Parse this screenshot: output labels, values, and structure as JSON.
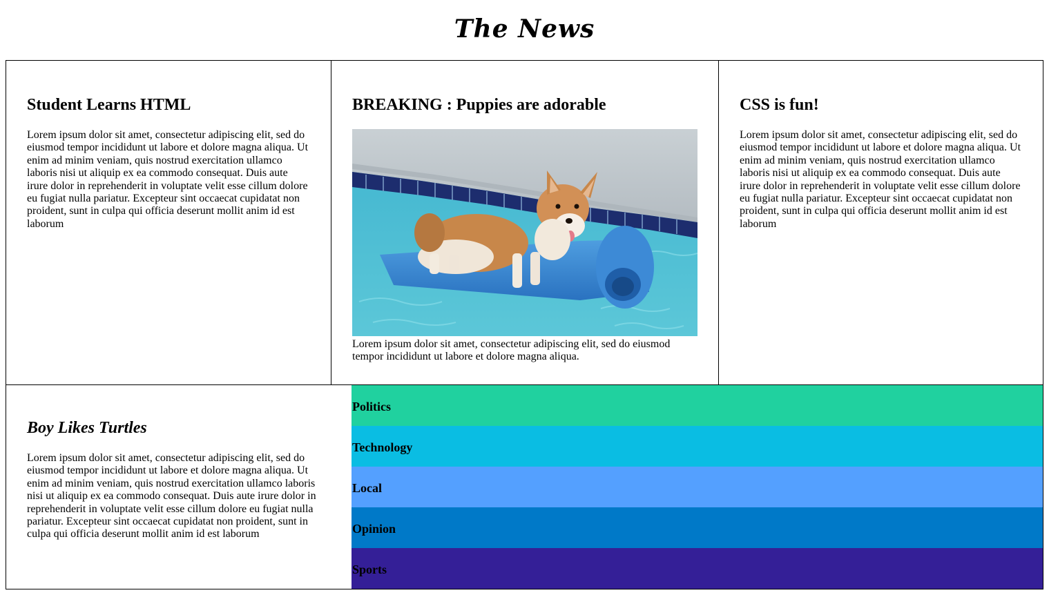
{
  "site": {
    "title": "The News"
  },
  "articles": [
    {
      "headline": "Student Learns HTML",
      "body": "Lorem ipsum dolor sit amet, consectetur adipiscing elit, sed do eiusmod tempor incididunt ut labore et dolore magna aliqua. Ut enim ad minim veniam, quis nostrud exercitation ullamco laboris nisi ut aliquip ex ea commodo consequat. Duis aute irure dolor in reprehenderit in voluptate velit esse cillum dolore eu fugiat nulla pariatur. Excepteur sint occaecat cupidatat non proident, sunt in culpa qui officia deserunt mollit anim id est laborum"
    },
    {
      "headline": "BREAKING : Puppies are adorable",
      "image": "corgi-on-pool-float-photo",
      "body": "Lorem ipsum dolor sit amet, consectetur adipiscing elit, sed do eiusmod tempor incididunt ut labore et dolore magna aliqua."
    },
    {
      "headline": "CSS is fun!",
      "body": "Lorem ipsum dolor sit amet, consectetur adipiscing elit, sed do eiusmod tempor incididunt ut labore et dolore magna aliqua. Ut enim ad minim veniam, quis nostrud exercitation ullamco laboris nisi ut aliquip ex ea commodo consequat. Duis aute irure dolor in reprehenderit in voluptate velit esse cillum dolore eu fugiat nulla pariatur. Excepteur sint occaecat cupidatat non proident, sunt in culpa qui officia deserunt mollit anim id est laborum"
    },
    {
      "headline": "Boy Likes Turtles",
      "body": "Lorem ipsum dolor sit amet, consectetur adipiscing elit, sed do eiusmod tempor incididunt ut labore et dolore magna aliqua. Ut enim ad minim veniam, quis nostrud exercitation ullamco laboris nisi ut aliquip ex ea commodo consequat. Duis aute irure dolor in reprehenderit in voluptate velit esse cillum dolore eu fugiat nulla pariatur. Excepteur sint occaecat cupidatat non proident, sunt in culpa qui officia deserunt mollit anim id est laborum"
    }
  ],
  "nav": {
    "items": [
      {
        "label": "Politics",
        "color": "#20d19f"
      },
      {
        "label": "Technology",
        "color": "#0abde3"
      },
      {
        "label": "Local",
        "color": "#54a0ff"
      },
      {
        "label": "Opinion",
        "color": "#0079c8"
      },
      {
        "label": "Sports",
        "color": "#341f97"
      }
    ]
  }
}
